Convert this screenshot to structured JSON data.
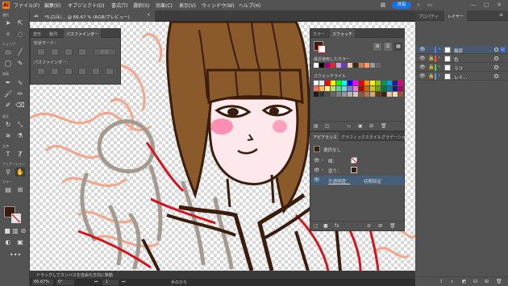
{
  "app": {
    "logo": "Ai",
    "menus": [
      "ファイル(F)",
      "編集(E)",
      "オブジェクト(O)",
      "書式(T)",
      "選択(S)",
      "効果(C)",
      "表示(V)",
      "ウィンドウ(W)",
      "ヘルプ(H)"
    ],
    "share_label": "共有",
    "window_controls": [
      "—",
      "□",
      "✕"
    ]
  },
  "document": {
    "tab_title": "*5ぷ(ほ)... @ 66.67 % (RGB/プレビュー)",
    "zoom": "66.67%",
    "rotation": "0°",
    "artboard": "1",
    "status_text": "ドラッグしてカンバスを自由な方向に移動",
    "artboard_label": "手のひら"
  },
  "toolbar": {
    "section_labels": [
      "選択",
      "シェイプ",
      "描画",
      "修正",
      "文字",
      "ナビゲーション",
      "カラー"
    ]
  },
  "pathfinder_panel": {
    "tabs": [
      "変形",
      "整列",
      "パスファインダー"
    ],
    "shape_mode_label": "形状モード：",
    "expand_label": "拡張",
    "pathfinder_label": "パスファインダー："
  },
  "swatches_panel": {
    "tabs": [
      "カラー",
      "スウォッチ"
    ],
    "recent_label": "最近使用したカラー",
    "swatch_group_label": "スウォッチライル",
    "recent_colors": [
      "#ffffff",
      "#000000",
      "#a1007a",
      "#e02b2b",
      "#c8a0d8",
      "#6b3bbd",
      "#e4c9a8",
      "#3d2b1f",
      "#c87f5e",
      "#ff9966",
      "#9a9a9a",
      "#6a6a6a"
    ],
    "grid_colors": [
      "#ffffff",
      "#e8e8e8",
      "#ff0000",
      "#ffff00",
      "#00ff00",
      "#00ffff",
      "#0000ff",
      "#ff00ff",
      "#e60012",
      "#f39800",
      "#fff100",
      "#8fc31f",
      "#009944",
      "#00a0e9",
      "#1d2088",
      "#e4007f",
      "#ff6b6b",
      "#ffb347",
      "#fff275",
      "#b2e672",
      "#5ed486",
      "#67d4f2",
      "#6f7ce0",
      "#f07ac3",
      "#bf0000",
      "#cc6600",
      "#cccc00",
      "#66aa00",
      "#007a33",
      "#0077bb",
      "#14178a",
      "#b3005f",
      "#1a1a1a",
      "#333333",
      "#4d4d4d",
      "#666666",
      "#808080",
      "#999999",
      "#b3b3b3",
      "#cccccc",
      "#8c5a3c",
      "#b07850",
      "#d4a373",
      "#5c3a21",
      "#3d2314",
      "#e6c4a3",
      "#f5deb3",
      "#a0522d"
    ]
  },
  "appearance_panel": {
    "tabs": [
      "アピアランス",
      "グラフィックスタイル",
      "グラデーション"
    ],
    "selection_label": "選択なし",
    "stroke_label": "線：",
    "fill_label": "塗り：",
    "opacity_label": "不透明度：",
    "opacity_value": "初期設定"
  },
  "layers_panel": {
    "tabs": [
      "プロパティ",
      "レイヤー"
    ],
    "layers": [
      {
        "name": "輪郭",
        "color": "#4f7bff"
      },
      {
        "name": "色",
        "color": "#ff4f4f"
      },
      {
        "name": "ラフ",
        "color": "#4fd84f"
      },
      {
        "name": "レイ...",
        "color": "#4f9cff"
      }
    ]
  },
  "colors": {
    "ui_dark": "#535353",
    "accent_blue": "#1473e6",
    "hair_brown": "#8b5a2b",
    "line_dark": "#3b1d0e",
    "blush": "#ff6fa0",
    "sketch_orange": "#f4a58a",
    "sketch_gray": "#a59a8f",
    "line_red": "#d4141c"
  }
}
